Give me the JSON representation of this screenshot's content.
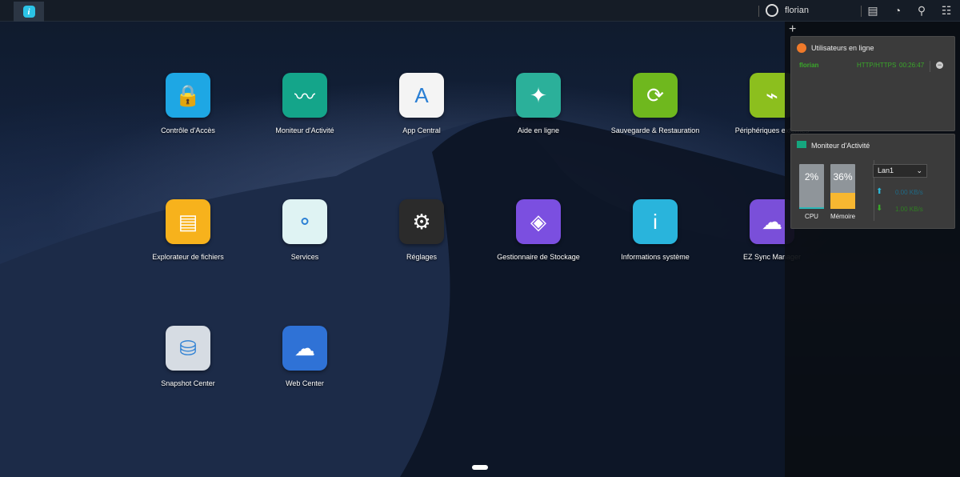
{
  "topbar": {
    "user": "florian",
    "icons": [
      "home-icon",
      "user-icon",
      "notification-icon",
      "dashboard-icon",
      "search-icon",
      "settings-panel-icon"
    ]
  },
  "apps": [
    {
      "label": "Contrôle d'Accès",
      "icon": "access-control-icon",
      "color": "#1ea7e4"
    },
    {
      "label": "Moniteur d'Activité",
      "icon": "activity-monitor-icon",
      "color": "#14a58a"
    },
    {
      "label": "App Central",
      "icon": "app-central-icon",
      "color": "#f4f4f4"
    },
    {
      "label": "Aide en ligne",
      "icon": "help-icon",
      "color": "#2bb09a"
    },
    {
      "label": "Sauvegarde & Restauration",
      "icon": "backup-icon",
      "color": "#6fb81e"
    },
    {
      "label": "Périphériques externes",
      "icon": "external-devices-icon",
      "color": "#8cbf1e"
    },
    {
      "label": "Explorateur de fichiers",
      "icon": "file-explorer-icon",
      "color": "#f7b21c"
    },
    {
      "label": "Services",
      "icon": "services-icon",
      "color": "#dff3f3"
    },
    {
      "label": "Réglages",
      "icon": "settings-icon",
      "color": "#2b2b2b"
    },
    {
      "label": "Gestionnaire de Stockage",
      "icon": "storage-manager-icon",
      "color": "#7b4fe0"
    },
    {
      "label": "Informations système",
      "icon": "info-icon",
      "color": "#29b4dc"
    },
    {
      "label": "EZ Sync Manager",
      "icon": "ez-sync-icon",
      "color": "#7a4fd9"
    },
    {
      "label": "Snapshot Center",
      "icon": "snapshot-icon",
      "color": "#d6dce3"
    },
    {
      "label": "Web Center",
      "icon": "web-center-icon",
      "color": "#2f72d6"
    }
  ],
  "online_users": {
    "title": "Utilisateurs en ligne",
    "rows": [
      {
        "user": "florian",
        "protocol": "HTTP/HTTPS",
        "duration": "00:26:47"
      }
    ]
  },
  "activity": {
    "title": "Moniteur d'Activité",
    "cpu_label": "CPU",
    "cpu": "2%",
    "cpu_value": 2,
    "mem_label": "Mémoire",
    "mem": "36%",
    "mem_value": 36,
    "interface": "Lan1",
    "upload": "0.00 KB/s",
    "download": "1.00 KB/s"
  }
}
